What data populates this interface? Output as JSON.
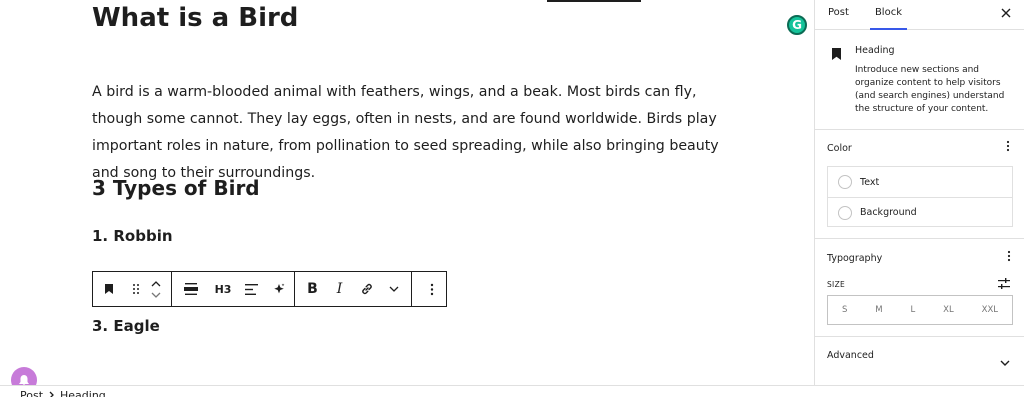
{
  "editor": {
    "title": "What is a Bird",
    "paragraph": "A bird is a warm-blooded animal with feathers, wings, and a beak. Most birds can fly, though some cannot. They lay eggs, often in nests, and are found worldwide. Birds play important roles in nature, from pollination to seed spreading, while also bringing beauty and song to their surroundings.",
    "heading_types": "3 Types of Bird",
    "heading_robbin": "1. Robbin",
    "heading_eagle": "3. Eagle",
    "toolbar": {
      "block_icon": "bookmark-icon",
      "drag_icon": "drag-handle-icon",
      "move_up_icon": "chevron-up-icon",
      "move_down_icon": "chevron-down-icon",
      "align_icon": "align-wide-icon",
      "heading_level": "H3",
      "text_align_icon": "text-align-icon",
      "ai_icon": "sparkle-icon",
      "bold": "B",
      "italic": "I",
      "link_icon": "link-icon",
      "more_icon": "chevron-down-icon",
      "options_icon": "kebab-menu-icon"
    }
  },
  "sidebar": {
    "tabs": [
      {
        "label": "Post",
        "active": false
      },
      {
        "label": "Block",
        "active": true
      }
    ],
    "close_icon": "close-icon",
    "block": {
      "icon": "bookmark-icon",
      "title": "Heading",
      "description": "Introduce new sections and organize content to help visitors (and search engines) understand the structure of your content."
    },
    "color": {
      "label": "Color",
      "items": [
        "Text",
        "Background"
      ]
    },
    "typography": {
      "label": "Typography",
      "size_label": "SIZE",
      "sizes": [
        "S",
        "M",
        "L",
        "XL",
        "XXL"
      ]
    },
    "advanced": {
      "label": "Advanced"
    }
  },
  "footer": {
    "breadcrumb": [
      "Post",
      "Heading"
    ]
  },
  "colors": {
    "accent": "#3858e9",
    "grammarly": "#15c39a",
    "notification": "#c77bd9",
    "border": "#e0e0e0",
    "text": "#1e1e1e"
  }
}
